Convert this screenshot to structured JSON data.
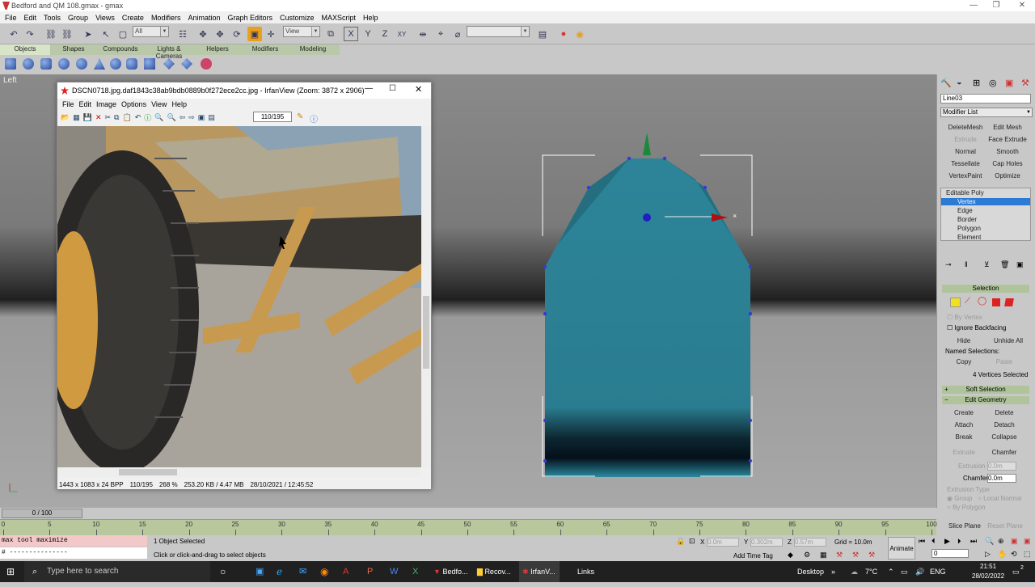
{
  "window": {
    "title": "Bedford and QM 108.gmax - gmax",
    "controls": [
      "—",
      "❐",
      "✕"
    ]
  },
  "menu": [
    "File",
    "Edit",
    "Tools",
    "Group",
    "Views",
    "Create",
    "Modifiers",
    "Animation",
    "Graph Editors",
    "Customize",
    "MAXScript",
    "Help"
  ],
  "toolbar": {
    "selection_filter": "All",
    "ref_coord": "View"
  },
  "tabs": [
    "Objects",
    "Shapes",
    "Compounds",
    "Lights & Cameras",
    "Helpers",
    "Modifiers",
    "Modeling"
  ],
  "viewport": {
    "label": "Left"
  },
  "irfanview": {
    "title": "DSCN0718.jpg.daf1843c38ab9bdb0889b0f272ece2cc.jpg - IrfanView (Zoom: 3872 x 2906)",
    "menu": [
      "File",
      "Edit",
      "Image",
      "Options",
      "View",
      "Help"
    ],
    "page": "110/195",
    "status": [
      "1443 x 1083 x 24 BPP",
      "110/195",
      "268 %",
      "253.20 KB / 4.47 MB",
      "28/10/2021 / 12:45:52"
    ]
  },
  "command_panel": {
    "object_name": "Line03",
    "modifier_list": "Modifier List",
    "modifier_buttons": [
      [
        "DeleteMesh",
        "Edit Mesh"
      ],
      [
        "Extrude",
        "Face Extrude"
      ],
      [
        "Normal",
        "Smooth"
      ],
      [
        "Tessellate",
        "Cap Holes"
      ],
      [
        "VertexPaint",
        "Optimize"
      ]
    ],
    "stack": {
      "root": "Editable Poly",
      "items": [
        "Vertex",
        "Edge",
        "Border",
        "Polygon",
        "Element"
      ],
      "selected": "Vertex"
    },
    "selection_rollout": "Selection",
    "by_vertex": "By Vertex",
    "ignore_backfacing": "Ignore Backfacing",
    "hide": "Hide",
    "unhide_all": "Unhide All",
    "named_selections": "Named Selections:",
    "copy": "Copy",
    "paste": "Paste",
    "selected_info": "4 Vertices Selected",
    "soft_selection": "Soft Selection",
    "edit_geometry": "Edit Geometry",
    "geo_buttons": [
      [
        "Create",
        "Delete"
      ],
      [
        "Attach",
        "Detach"
      ],
      [
        "Break",
        "Collapse"
      ]
    ],
    "extrude_btn": "Extrude",
    "chamfer_btn": "Chamfer",
    "extrusion_label": "Extrusion",
    "extrusion_val": "0.0m",
    "chamfer_label": "Chamfer",
    "chamfer_val": "0.0m",
    "extrusion_type": "Extrusion Type",
    "group": "Group",
    "local_normal": "Local Normal",
    "by_polygon": "By Polygon",
    "slice_plane": "Slice Plane",
    "reset_plane": "Reset Plane"
  },
  "timeline": {
    "frame": "0 / 100",
    "ticks": [
      "0",
      "5",
      "10",
      "15",
      "20",
      "25",
      "30",
      "35",
      "40",
      "45",
      "50",
      "55",
      "60",
      "65",
      "70",
      "75",
      "80",
      "85",
      "90",
      "95",
      "100"
    ]
  },
  "status": {
    "listener_1": "max tool maximize",
    "listener_2": "# ---------------",
    "selected": "1 Object Selected",
    "prompt": "Click or click-and-drag to select objects",
    "x_label": "X",
    "x_val": "0.0m",
    "y_label": "Y",
    "y_val": "0.302m",
    "z_label": "Z",
    "z_val": "0.57m",
    "grid": "Grid = 10.0m",
    "add_time_tag": "Add Time Tag",
    "animate": "Animate",
    "frame_field": "0"
  },
  "taskbar": {
    "search": "Type here to search",
    "apps": [
      "Bedfo...",
      "Recov...",
      "IrfanV..."
    ],
    "links": "Links",
    "desktop": "Desktop",
    "weather": "7°C",
    "lang": "ENG",
    "time": "21:51",
    "date": "28/02/2022",
    "notif": "2"
  },
  "colors": {
    "model": "#2d7d8f",
    "panel_green": "#b0c49c",
    "vertex": "#3a3ad0",
    "selected_stack": "#2a7ad6"
  }
}
